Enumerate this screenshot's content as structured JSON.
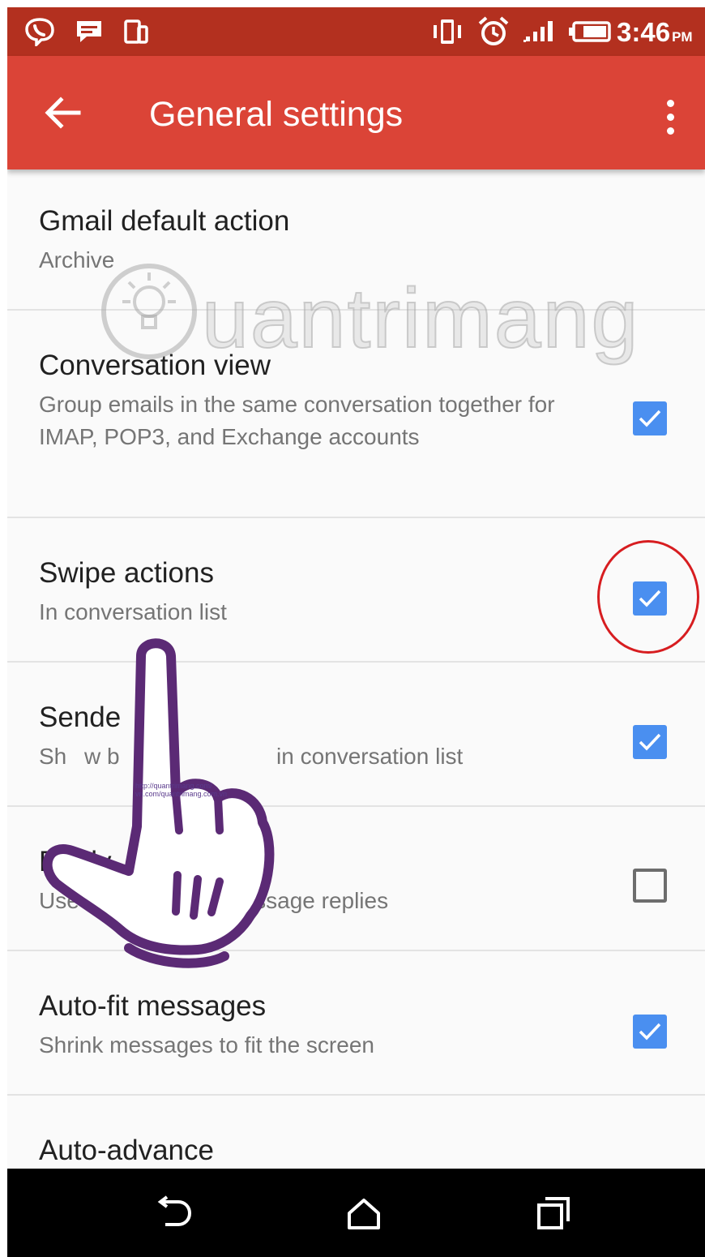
{
  "status_bar": {
    "time": "3:46",
    "ampm": "PM",
    "icons": [
      "viber-icon",
      "chat-icon",
      "phone-copy-icon",
      "vibrate-icon",
      "alarm-icon",
      "signal-icon",
      "battery-icon"
    ]
  },
  "app_bar": {
    "title": "General settings",
    "back_icon": "arrow-back-icon",
    "menu_icon": "more-vert-icon",
    "color": "#db4437"
  },
  "settings": [
    {
      "title": "Gmail default action",
      "subtitle": "Archive"
    },
    {
      "title": "Conversation view",
      "subtitle": "Group emails in the same conversation together for IMAP, POP3, and Exchange accounts",
      "checked": true
    },
    {
      "title": "Swipe actions",
      "subtitle": "In conversation list",
      "checked": true
    },
    {
      "title": "Sende",
      "subtitle_left": "Sh",
      "subtitle_mid": "w b",
      "subtitle_right": "in conversation list",
      "checked": true
    },
    {
      "title": "Reply",
      "subtitle": "Use as default for message replies",
      "checked": false
    },
    {
      "title": "Auto-fit messages",
      "subtitle": "Shrink messages to fit the screen",
      "checked": true
    },
    {
      "title": "Auto-advance"
    }
  ],
  "watermark": {
    "text": "uantrimang"
  },
  "hand_overlay": {
    "url_line1": "http://quantrimang.com/",
    "url_line2": "vn.com/quantrimang.com.vn"
  },
  "nav_bar": {
    "icons": [
      "back-nav-icon",
      "home-nav-icon",
      "recents-nav-icon"
    ]
  },
  "colors": {
    "checkbox": "#4a8ff0",
    "highlight": "#d71d20",
    "status_bar": "#b3301f"
  }
}
